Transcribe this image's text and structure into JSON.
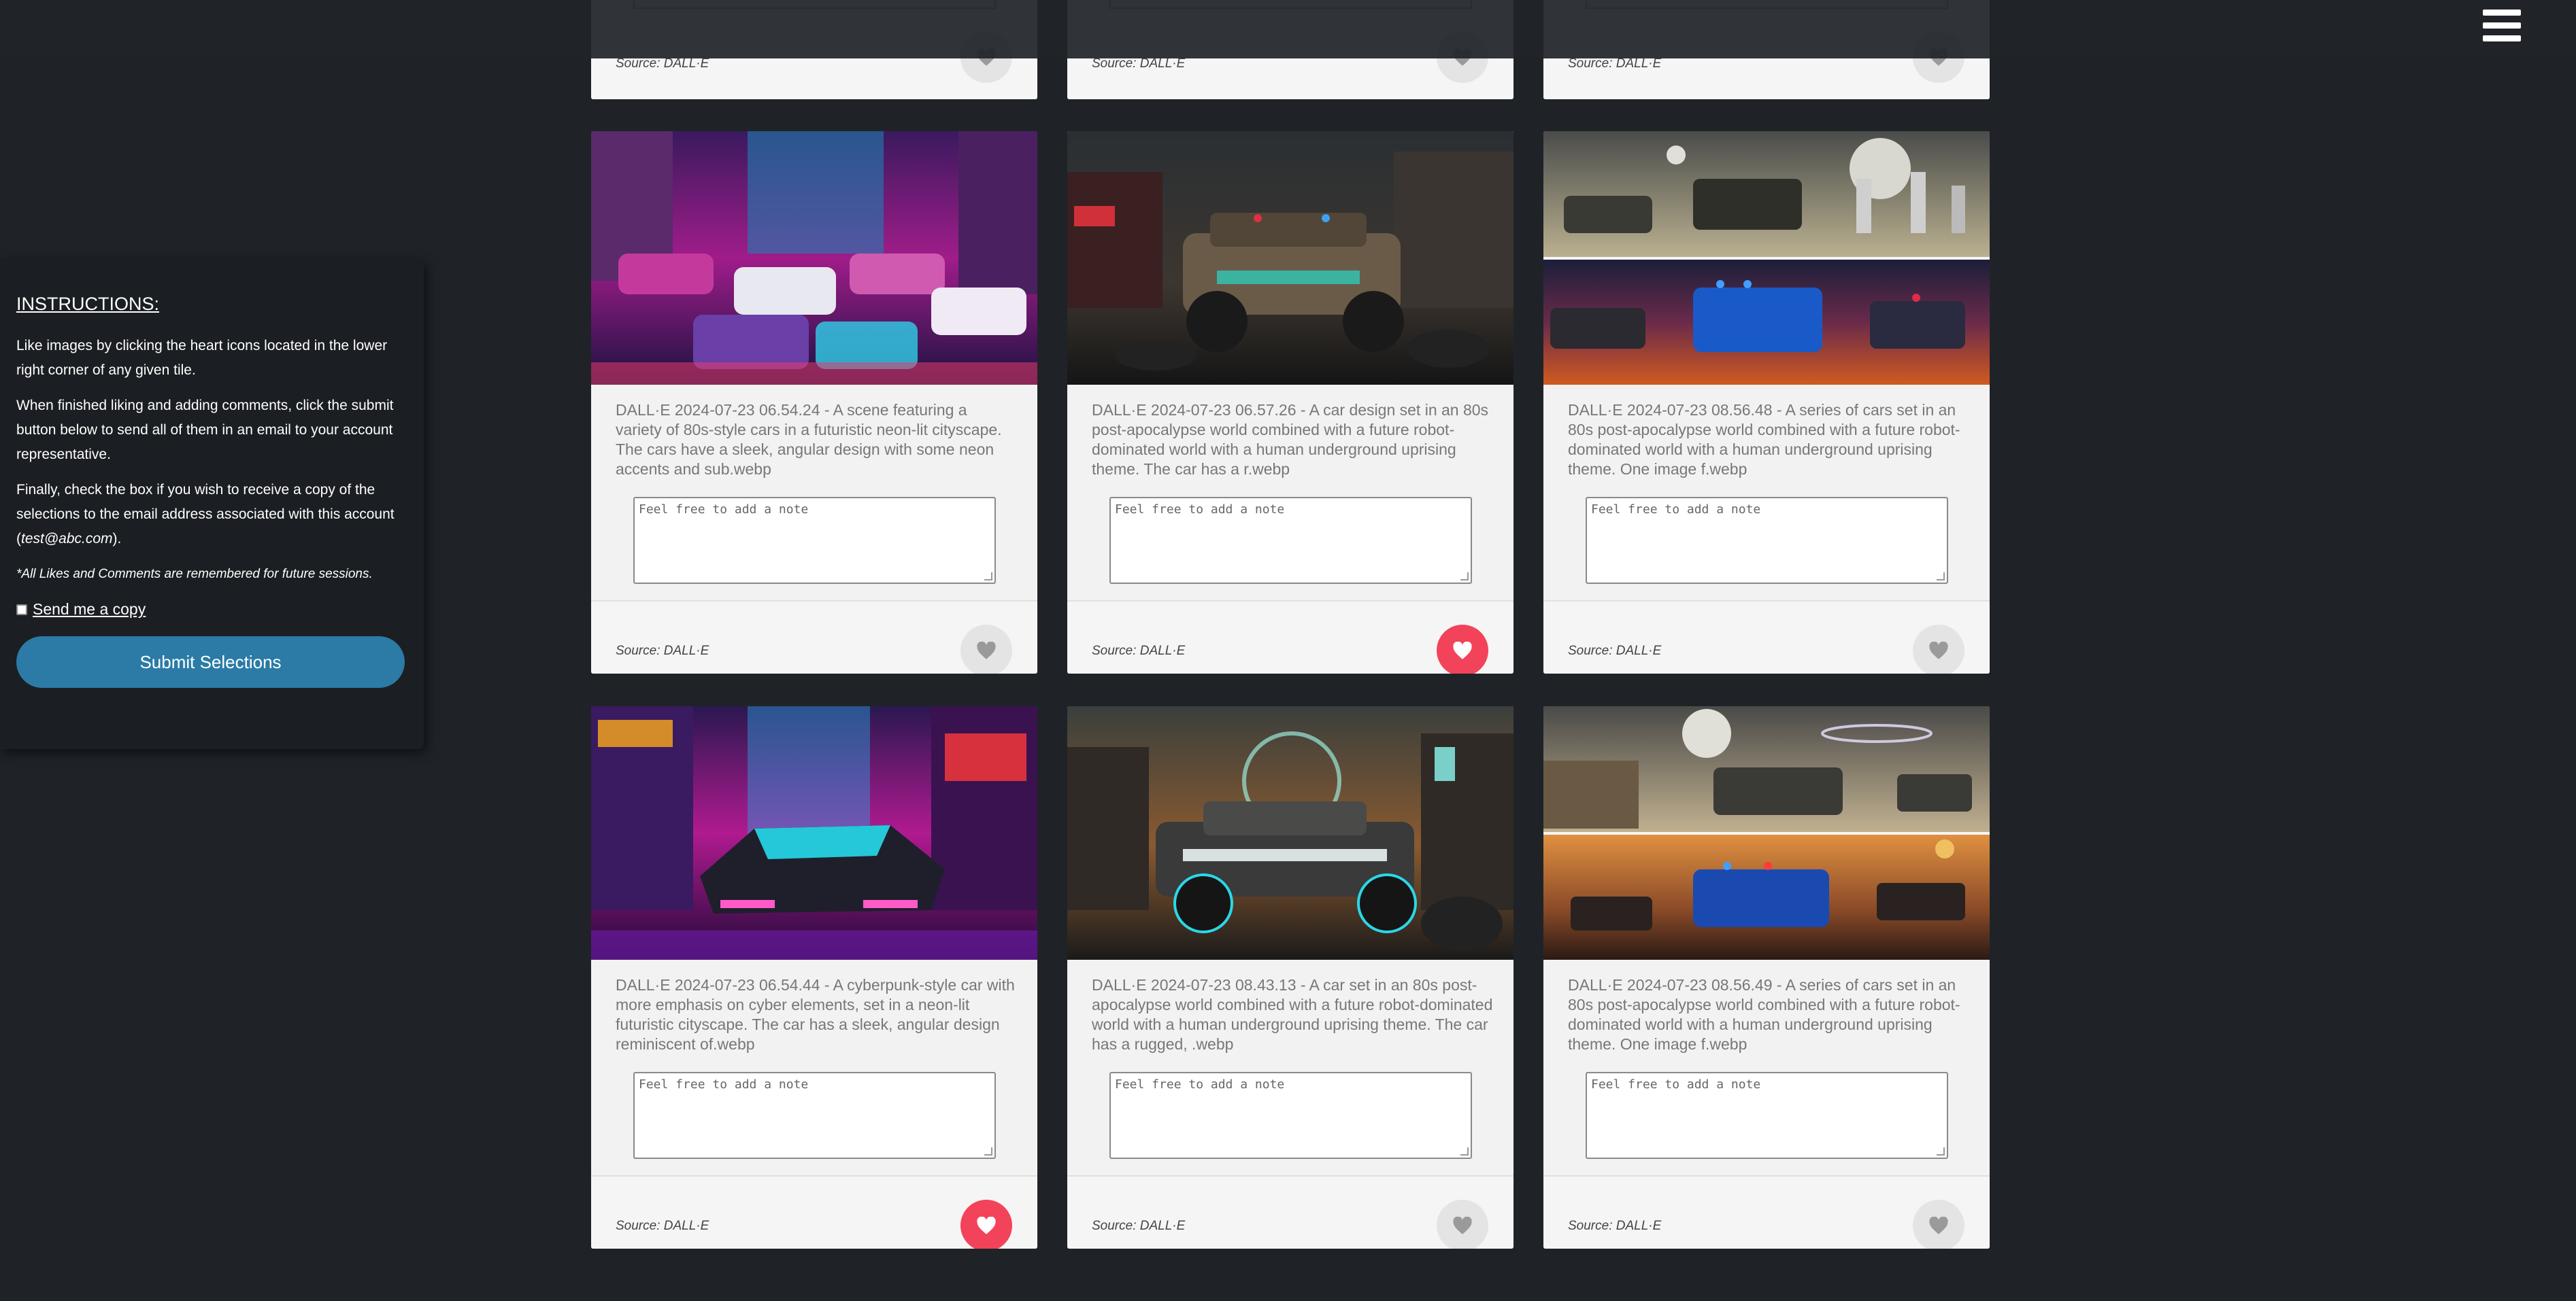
{
  "header": {
    "menu_icon": "hamburger-menu-icon"
  },
  "instructions": {
    "title": "INSTRUCTIONS:",
    "p1": "Like images by clicking the heart icons located in the lower right corner of any given tile.",
    "p2": "When finished liking and adding comments, click the submit button below to send all of them in an email to your account representative.",
    "p3_before": "Finally, check the box if you wish to receive a copy of the selections to the email address associated with this account (",
    "p3_email": "test@abc.com",
    "p3_after": ").",
    "note": "*All Likes and Comments are remembered for future sessions.",
    "send_copy_label": "Send me a copy",
    "send_copy_checked": false,
    "submit_label": "Submit Selections"
  },
  "note_placeholder": "Feel free to add a note",
  "partial_cards": [
    {
      "source": "Source: DALL·E",
      "liked": false
    },
    {
      "source": "Source: DALL·E",
      "liked": false
    },
    {
      "source": "Source: DALL·E",
      "liked": false
    }
  ],
  "cards": [
    {
      "description": "DALL·E 2024-07-23 06.54.24 - A scene featuring a variety of 80s-style cars in a futuristic neon-lit cityscape. The cars have a sleek, angular design with some neon accents and sub.webp",
      "source": "Source: DALL·E",
      "liked": false,
      "theme": "neon-city"
    },
    {
      "description": "DALL·E 2024-07-23 06.57.26 - A car design set in an 80s post-apocalypse world combined with a future robot-dominated world with a human underground uprising theme. The car has a r.webp",
      "source": "Source: DALL·E",
      "liked": true,
      "theme": "apocalypse-dark"
    },
    {
      "description": "DALL·E 2024-07-23 08.56.48 - A series of cars set in an 80s post-apocalypse world combined with a future robot-dominated world with a human underground uprising theme. One image f.webp",
      "source": "Source: DALL·E",
      "liked": false,
      "theme": "split-desert"
    },
    {
      "description": "DALL·E 2024-07-23 06.54.44 - A cyberpunk-style car with more emphasis on cyber elements, set in a neon-lit futuristic cityscape. The car has a sleek, angular design reminiscent of.webp",
      "source": "Source: DALL·E",
      "liked": true,
      "theme": "cyberpunk"
    },
    {
      "description": "DALL·E 2024-07-23 08.43.13 - A car set in an 80s post-apocalypse world combined with a future robot-dominated world with a human underground uprising theme. The car has a rugged, .webp",
      "source": "Source: DALL·E",
      "liked": false,
      "theme": "apocalypse-sunset"
    },
    {
      "description": "DALL·E 2024-07-23 08.56.49 - A series of cars set in an 80s post-apocalypse world combined with a future robot-dominated world with a human underground uprising theme. One image f.webp",
      "source": "Source: DALL·E",
      "liked": false,
      "theme": "split-sunset"
    }
  ]
}
